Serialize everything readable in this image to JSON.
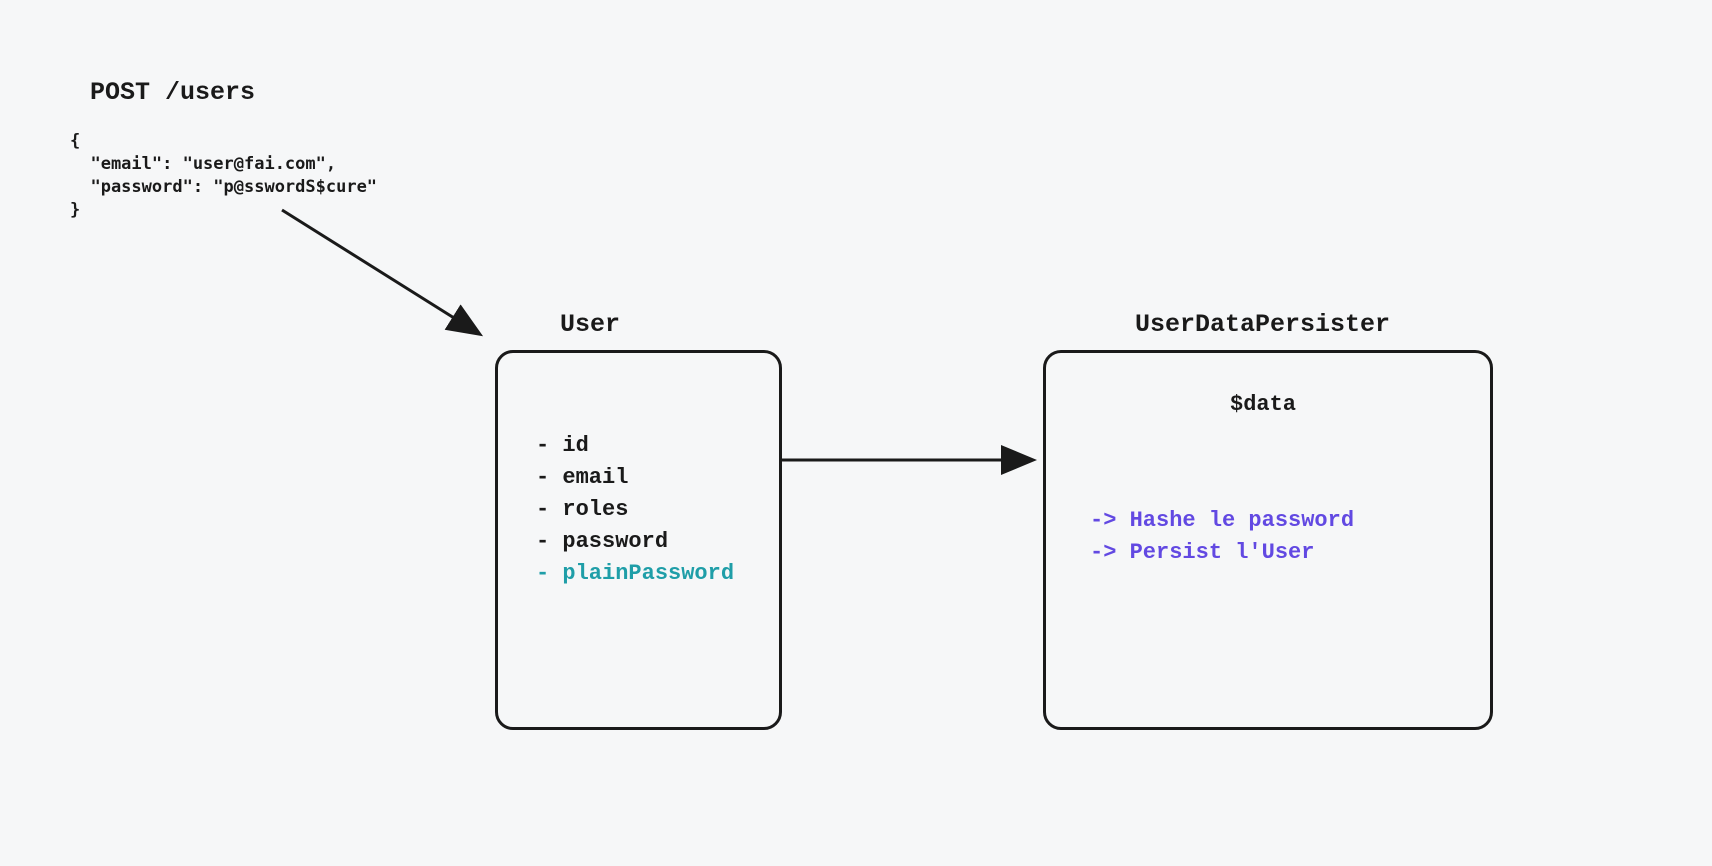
{
  "request": {
    "title": "POST /users",
    "body": "{\n  \"email\": \"user@fai.com\",\n  \"password\": \"p@sswordS$cure\"\n}"
  },
  "user": {
    "title": "User",
    "fields": [
      {
        "label": "id",
        "highlight": false
      },
      {
        "label": "email",
        "highlight": false
      },
      {
        "label": "roles",
        "highlight": false
      },
      {
        "label": "password",
        "highlight": false
      },
      {
        "label": "plainPassword",
        "highlight": true
      }
    ]
  },
  "persister": {
    "title": "UserDataPersister",
    "data_var": "$data",
    "actions": [
      "Hashe le password",
      "Persist l'User"
    ]
  },
  "colors": {
    "highlight": "#1f9ea8",
    "action": "#6249e2",
    "stroke": "#1a1a1a",
    "bg": "#f6f7f8"
  }
}
